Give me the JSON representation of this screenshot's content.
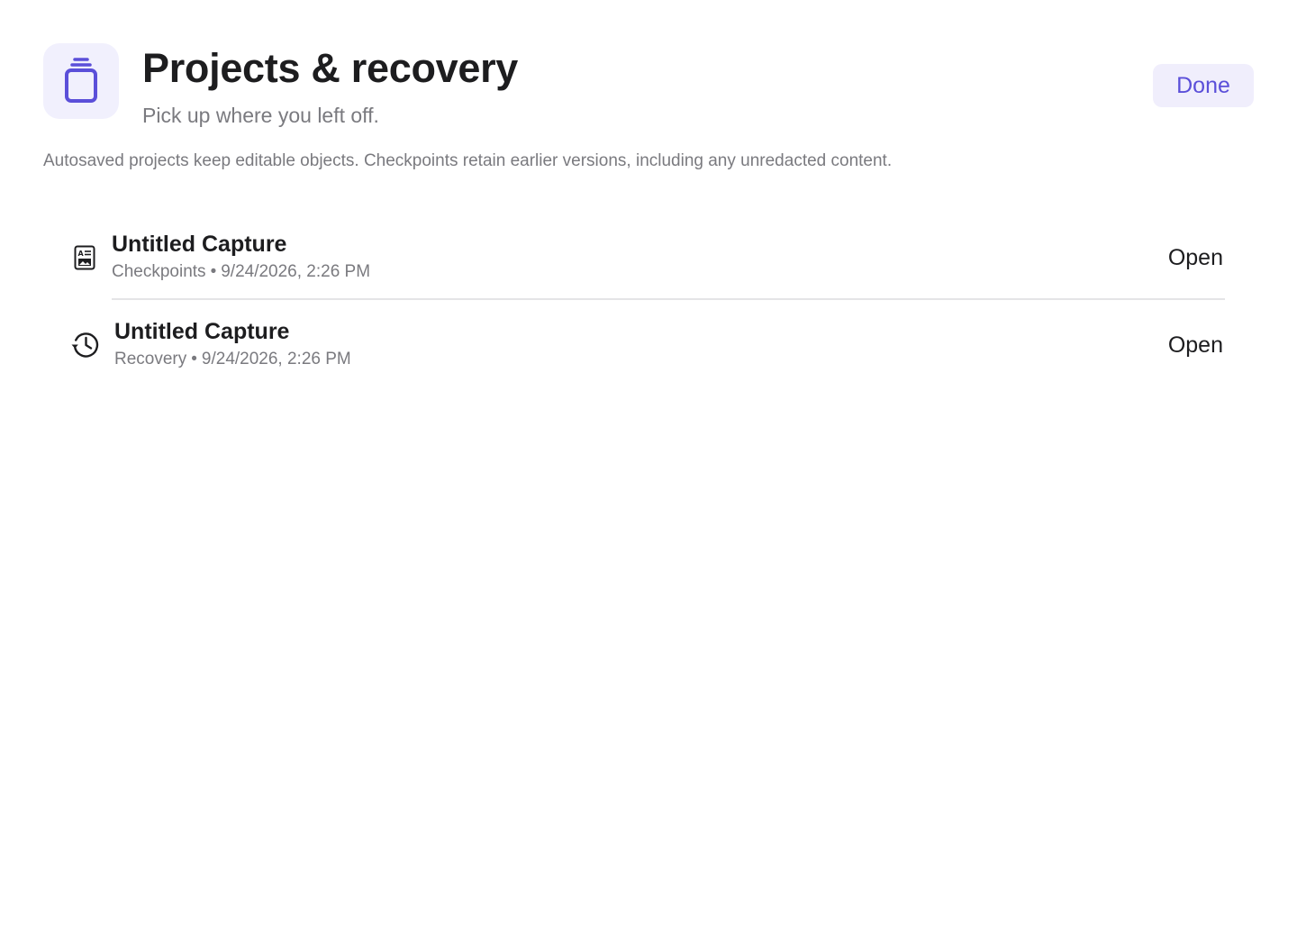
{
  "header": {
    "app_icon": "stacked-square-icon",
    "title": "Projects & recovery",
    "subtitle": "Pick up where you left off.",
    "done_label": "Done"
  },
  "notice": "Autosaved projects keep editable objects. Checkpoints retain earlier versions, including any unredacted content.",
  "projects": [
    {
      "icon": "document-checkpoint-icon",
      "name": "Untitled Capture",
      "kind": "Checkpoints",
      "separator": "•",
      "timestamp": "9/24/2026, 2:26 PM",
      "action_label": "Open"
    },
    {
      "icon": "history-clock-icon",
      "name": "Untitled Capture",
      "kind": "Recovery",
      "separator": "•",
      "timestamp": "9/24/2026, 2:26 PM",
      "action_label": "Open"
    }
  ],
  "colors": {
    "accent": "#5b4fd9",
    "accent_bg": "#f0eefc",
    "text_primary": "#1d1d1f",
    "text_secondary": "#7a7a7f",
    "divider": "#e4e4e6"
  }
}
